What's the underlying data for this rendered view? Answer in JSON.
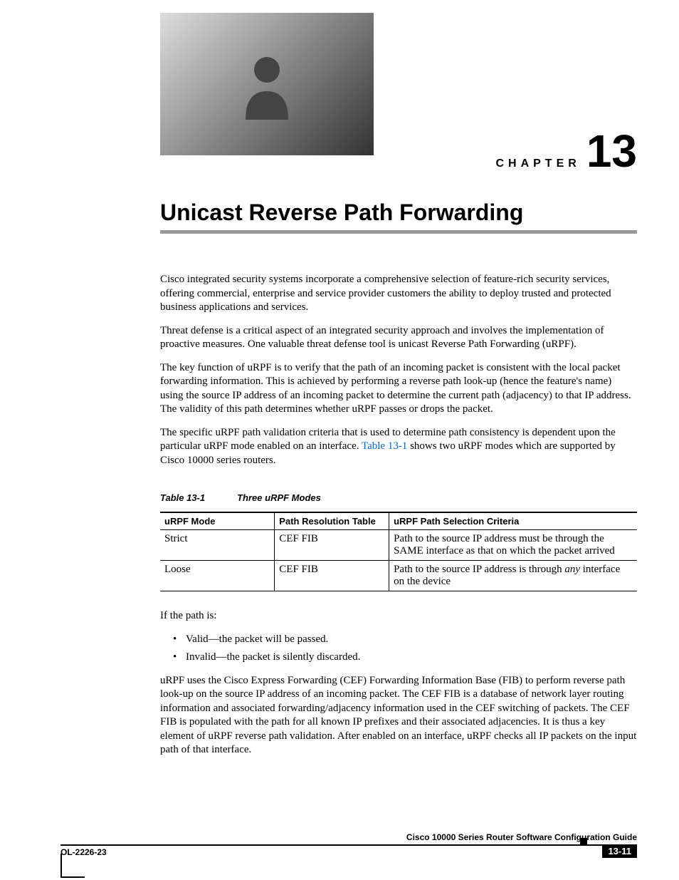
{
  "chapter": {
    "label": "CHAPTER",
    "number": "13"
  },
  "title": "Unicast Reverse Path Forwarding",
  "paragraphs": {
    "p1": "Cisco integrated security systems incorporate a comprehensive selection of feature-rich security services, offering commercial, enterprise and service provider customers the ability to deploy trusted and protected business applications and services.",
    "p2": "Threat defense is a critical aspect of an integrated security approach and involves the implementation of proactive measures. One valuable threat defense tool is unicast Reverse Path Forwarding (uRPF).",
    "p3": "The key function of uRPF is to verify that the path of an incoming packet is consistent with the local packet forwarding information. This is achieved by performing a reverse path look-up (hence the feature's name) using the source IP address of an incoming packet to determine the current path (adjacency) to that IP address. The validity of this path determines whether uRPF passes or drops the packet.",
    "p4_a": "The specific uRPF path validation criteria that is used to determine path consistency is dependent upon the particular uRPF mode enabled on an interface. ",
    "p4_link": "Table 13-1",
    "p4_b": " shows two uRPF modes which are supported by Cisco 10000 series routers.",
    "if_path": "If the path is:",
    "bullet1": "Valid—the packet will be passed.",
    "bullet2": "Invalid—the packet is silently discarded.",
    "p5": "uRPF uses the Cisco Express Forwarding (CEF) Forwarding Information Base (FIB) to perform reverse path look-up on the source IP address of an incoming packet. The CEF FIB is a database of network layer routing information and associated forwarding/adjacency information used in the CEF switching of packets. The CEF FIB is populated with the path for all known IP prefixes and their associated adjacencies. It is thus a key element of uRPF reverse path validation. After enabled on an interface, uRPF checks all IP packets on the input path of that interface."
  },
  "table": {
    "caption_num": "Table 13-1",
    "caption_title": "Three uRPF Modes",
    "headers": {
      "c1": "uRPF Mode",
      "c2": "Path Resolution Table",
      "c3": "uRPF Path Selection Criteria"
    },
    "rows": [
      {
        "mode": "Strict",
        "resolution": "CEF FIB",
        "criteria": "Path to the source IP address must be through the SAME interface as that on which the packet arrived"
      },
      {
        "mode": "Loose",
        "resolution": "CEF FIB",
        "criteria_a": "Path to the source IP address is through ",
        "criteria_em": "any",
        "criteria_b": " interface on the device"
      }
    ]
  },
  "footer": {
    "guide": "Cisco 10000 Series Router Software Configuration Guide",
    "doc_id": "OL-2226-23",
    "page": "13-11"
  }
}
